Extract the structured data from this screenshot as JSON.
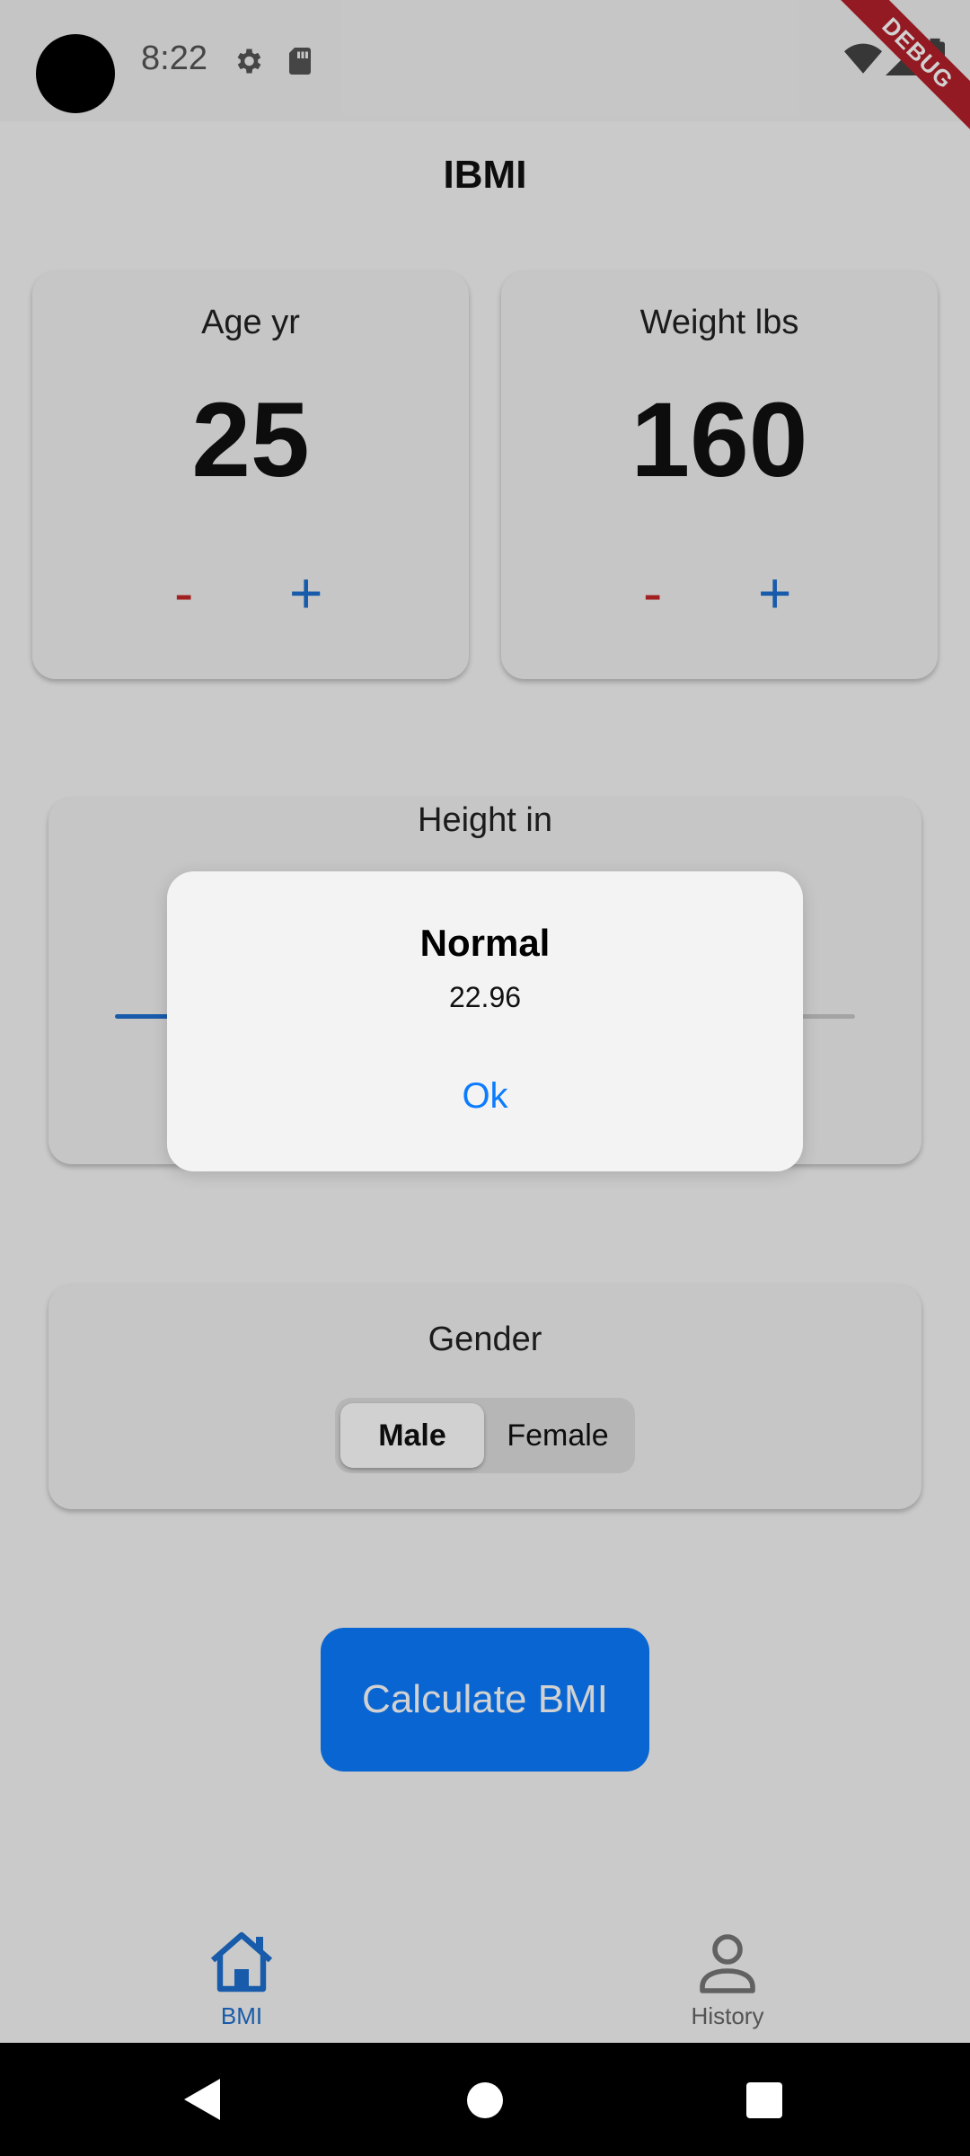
{
  "status_bar": {
    "time": "8:22",
    "icons": [
      "settings-icon",
      "sd-card-icon",
      "wifi-icon",
      "signal-icon",
      "battery-icon"
    ],
    "debug_banner": "DEBUG"
  },
  "app_bar": {
    "title": "IBMI"
  },
  "age_card": {
    "label": "Age yr",
    "value": "25",
    "decrement": "-",
    "increment": "+"
  },
  "weight_card": {
    "label": "Weight lbs",
    "value": "160",
    "decrement": "-",
    "increment": "+"
  },
  "height_card": {
    "label": "Height in",
    "slider_fraction": 0.5
  },
  "gender_card": {
    "label": "Gender",
    "options": [
      "Male",
      "Female"
    ],
    "selected": "Male"
  },
  "calculate_button": {
    "label": "Calculate BMI"
  },
  "bottom_nav": {
    "items": [
      {
        "label": "BMI",
        "icon": "home-icon",
        "active": true
      },
      {
        "label": "History",
        "icon": "person-icon",
        "active": false
      }
    ]
  },
  "dialog": {
    "title": "Normal",
    "message": "22.96",
    "button": "Ok"
  },
  "colors": {
    "accent": "#0b7cff",
    "decrement": "#c62828",
    "increment": "#1e6fd0"
  }
}
